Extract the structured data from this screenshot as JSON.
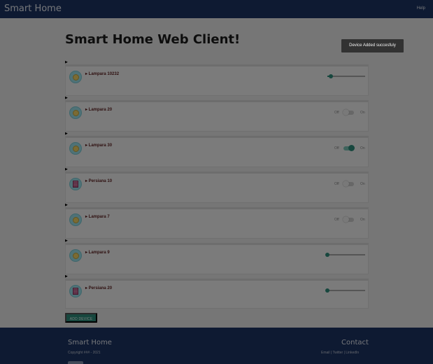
{
  "header": {
    "brand": "Smart Home",
    "help": "Help"
  },
  "main": {
    "title": "Smart Home Web Client!"
  },
  "toast": {
    "message": "Device Added succesfuly"
  },
  "devices": [
    {
      "name": "Lampara 10232",
      "icon": "lightbulb-icon",
      "control": "slider",
      "level": 0.1
    },
    {
      "name": "Lampara 20",
      "icon": "lightbulb-icon",
      "control": "toggle",
      "off_label": "Off",
      "on_label": "On",
      "on": false
    },
    {
      "name": "Lampara 30",
      "icon": "lightbulb-icon",
      "control": "toggle",
      "off_label": "Off",
      "on_label": "On",
      "on": true
    },
    {
      "name": "Persiana 10",
      "icon": "blinds-icon",
      "control": "toggle",
      "off_label": "Off",
      "on_label": "On",
      "on": false
    },
    {
      "name": "Lampara 7",
      "icon": "lightbulb-icon",
      "control": "toggle",
      "off_label": "Off",
      "on_label": "On",
      "on": false
    },
    {
      "name": "Lampara 9",
      "icon": "lightbulb-icon",
      "control": "slider",
      "level": 0.0
    },
    {
      "name": "Persiana 20",
      "icon": "blinds-icon",
      "control": "slider",
      "level": 0.0
    }
  ],
  "add_device": {
    "label": "ADD DEVICE"
  },
  "footer": {
    "brand": "Smart Home",
    "copyright": "Copyright ### - 2021",
    "contact_title": "Contact",
    "links": "Email | Twitter | LinkedIn"
  },
  "colors": {
    "navbar": "#1d3464",
    "accent": "#2e8f7d",
    "toast": "#323232"
  }
}
